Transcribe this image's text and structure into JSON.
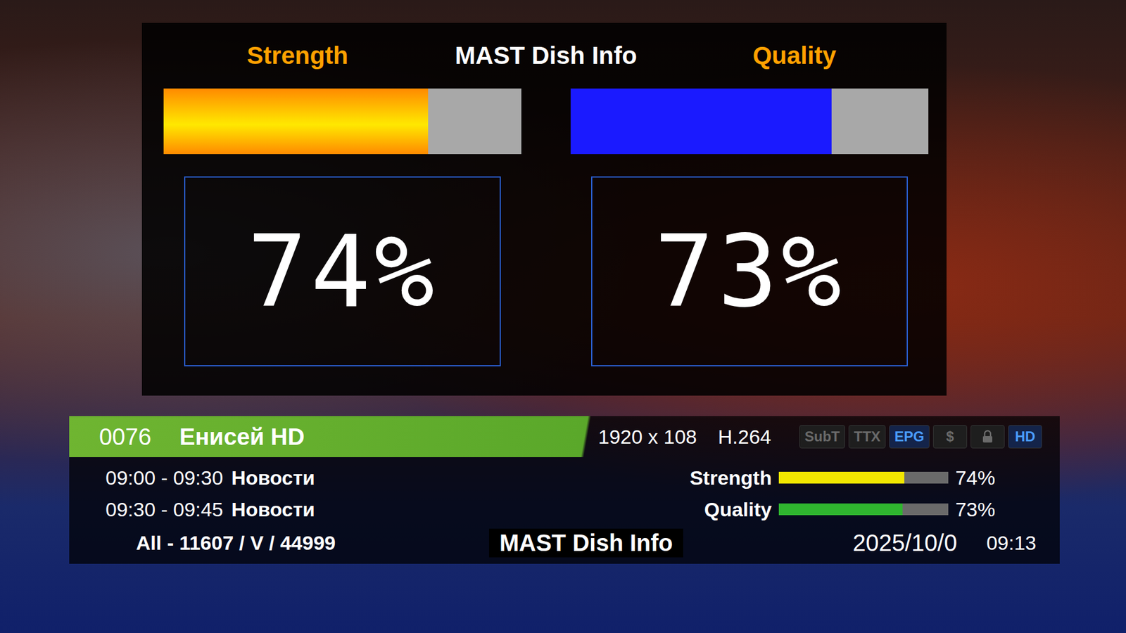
{
  "dish_info": {
    "title": "MAST Dish Info",
    "meters": [
      {
        "label": "Strength",
        "kind": "strength",
        "level": 0.74,
        "reading": "74%"
      },
      {
        "label": "Quality",
        "kind": "quality",
        "level": 0.73,
        "reading": "73%"
      }
    ]
  },
  "channel_bar": {
    "number": "0076",
    "name": "Енисей HD",
    "resolution": "1920 x 108",
    "codec": "H.264",
    "badges": [
      {
        "kind": "text",
        "label": "SubT",
        "on": false
      },
      {
        "kind": "text",
        "label": "TTX",
        "on": false
      },
      {
        "kind": "text",
        "label": "EPG",
        "on": true
      },
      {
        "kind": "text",
        "label": "$",
        "on": false
      },
      {
        "kind": "lock",
        "on": false
      },
      {
        "kind": "text",
        "label": "HD",
        "on": true
      }
    ],
    "events": [
      {
        "time": "09:00 - 09:30",
        "title": "Новости"
      },
      {
        "time": "09:30 - 09:45",
        "title": "Новости"
      }
    ],
    "meters": [
      {
        "label": "Strength",
        "level": 0.74,
        "reading": "74%",
        "color": "#f2e600"
      },
      {
        "label": "Quality",
        "level": 0.73,
        "reading": "73%",
        "color": "#2fb52f"
      }
    ],
    "transponder": "All - 11607 / V / 44999",
    "footer_title": "MAST Dish Info",
    "date": "2025/10/0",
    "time": "09:13"
  }
}
